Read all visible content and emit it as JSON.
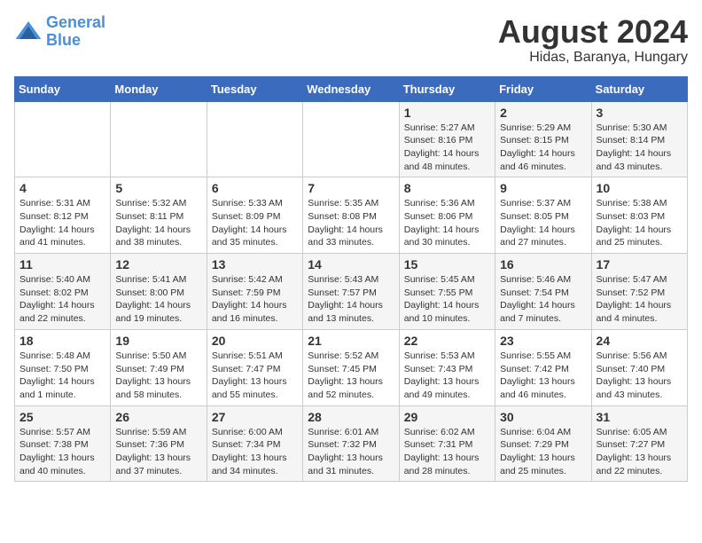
{
  "logo": {
    "line1": "General",
    "line2": "Blue"
  },
  "title": "August 2024",
  "subtitle": "Hidas, Baranya, Hungary",
  "days_of_week": [
    "Sunday",
    "Monday",
    "Tuesday",
    "Wednesday",
    "Thursday",
    "Friday",
    "Saturday"
  ],
  "weeks": [
    [
      {
        "day": "",
        "info": ""
      },
      {
        "day": "",
        "info": ""
      },
      {
        "day": "",
        "info": ""
      },
      {
        "day": "",
        "info": ""
      },
      {
        "day": "1",
        "info": "Sunrise: 5:27 AM\nSunset: 8:16 PM\nDaylight: 14 hours\nand 48 minutes."
      },
      {
        "day": "2",
        "info": "Sunrise: 5:29 AM\nSunset: 8:15 PM\nDaylight: 14 hours\nand 46 minutes."
      },
      {
        "day": "3",
        "info": "Sunrise: 5:30 AM\nSunset: 8:14 PM\nDaylight: 14 hours\nand 43 minutes."
      }
    ],
    [
      {
        "day": "4",
        "info": "Sunrise: 5:31 AM\nSunset: 8:12 PM\nDaylight: 14 hours\nand 41 minutes."
      },
      {
        "day": "5",
        "info": "Sunrise: 5:32 AM\nSunset: 8:11 PM\nDaylight: 14 hours\nand 38 minutes."
      },
      {
        "day": "6",
        "info": "Sunrise: 5:33 AM\nSunset: 8:09 PM\nDaylight: 14 hours\nand 35 minutes."
      },
      {
        "day": "7",
        "info": "Sunrise: 5:35 AM\nSunset: 8:08 PM\nDaylight: 14 hours\nand 33 minutes."
      },
      {
        "day": "8",
        "info": "Sunrise: 5:36 AM\nSunset: 8:06 PM\nDaylight: 14 hours\nand 30 minutes."
      },
      {
        "day": "9",
        "info": "Sunrise: 5:37 AM\nSunset: 8:05 PM\nDaylight: 14 hours\nand 27 minutes."
      },
      {
        "day": "10",
        "info": "Sunrise: 5:38 AM\nSunset: 8:03 PM\nDaylight: 14 hours\nand 25 minutes."
      }
    ],
    [
      {
        "day": "11",
        "info": "Sunrise: 5:40 AM\nSunset: 8:02 PM\nDaylight: 14 hours\nand 22 minutes."
      },
      {
        "day": "12",
        "info": "Sunrise: 5:41 AM\nSunset: 8:00 PM\nDaylight: 14 hours\nand 19 minutes."
      },
      {
        "day": "13",
        "info": "Sunrise: 5:42 AM\nSunset: 7:59 PM\nDaylight: 14 hours\nand 16 minutes."
      },
      {
        "day": "14",
        "info": "Sunrise: 5:43 AM\nSunset: 7:57 PM\nDaylight: 14 hours\nand 13 minutes."
      },
      {
        "day": "15",
        "info": "Sunrise: 5:45 AM\nSunset: 7:55 PM\nDaylight: 14 hours\nand 10 minutes."
      },
      {
        "day": "16",
        "info": "Sunrise: 5:46 AM\nSunset: 7:54 PM\nDaylight: 14 hours\nand 7 minutes."
      },
      {
        "day": "17",
        "info": "Sunrise: 5:47 AM\nSunset: 7:52 PM\nDaylight: 14 hours\nand 4 minutes."
      }
    ],
    [
      {
        "day": "18",
        "info": "Sunrise: 5:48 AM\nSunset: 7:50 PM\nDaylight: 14 hours\nand 1 minute."
      },
      {
        "day": "19",
        "info": "Sunrise: 5:50 AM\nSunset: 7:49 PM\nDaylight: 13 hours\nand 58 minutes."
      },
      {
        "day": "20",
        "info": "Sunrise: 5:51 AM\nSunset: 7:47 PM\nDaylight: 13 hours\nand 55 minutes."
      },
      {
        "day": "21",
        "info": "Sunrise: 5:52 AM\nSunset: 7:45 PM\nDaylight: 13 hours\nand 52 minutes."
      },
      {
        "day": "22",
        "info": "Sunrise: 5:53 AM\nSunset: 7:43 PM\nDaylight: 13 hours\nand 49 minutes."
      },
      {
        "day": "23",
        "info": "Sunrise: 5:55 AM\nSunset: 7:42 PM\nDaylight: 13 hours\nand 46 minutes."
      },
      {
        "day": "24",
        "info": "Sunrise: 5:56 AM\nSunset: 7:40 PM\nDaylight: 13 hours\nand 43 minutes."
      }
    ],
    [
      {
        "day": "25",
        "info": "Sunrise: 5:57 AM\nSunset: 7:38 PM\nDaylight: 13 hours\nand 40 minutes."
      },
      {
        "day": "26",
        "info": "Sunrise: 5:59 AM\nSunset: 7:36 PM\nDaylight: 13 hours\nand 37 minutes."
      },
      {
        "day": "27",
        "info": "Sunrise: 6:00 AM\nSunset: 7:34 PM\nDaylight: 13 hours\nand 34 minutes."
      },
      {
        "day": "28",
        "info": "Sunrise: 6:01 AM\nSunset: 7:32 PM\nDaylight: 13 hours\nand 31 minutes."
      },
      {
        "day": "29",
        "info": "Sunrise: 6:02 AM\nSunset: 7:31 PM\nDaylight: 13 hours\nand 28 minutes."
      },
      {
        "day": "30",
        "info": "Sunrise: 6:04 AM\nSunset: 7:29 PM\nDaylight: 13 hours\nand 25 minutes."
      },
      {
        "day": "31",
        "info": "Sunrise: 6:05 AM\nSunset: 7:27 PM\nDaylight: 13 hours\nand 22 minutes."
      }
    ]
  ]
}
